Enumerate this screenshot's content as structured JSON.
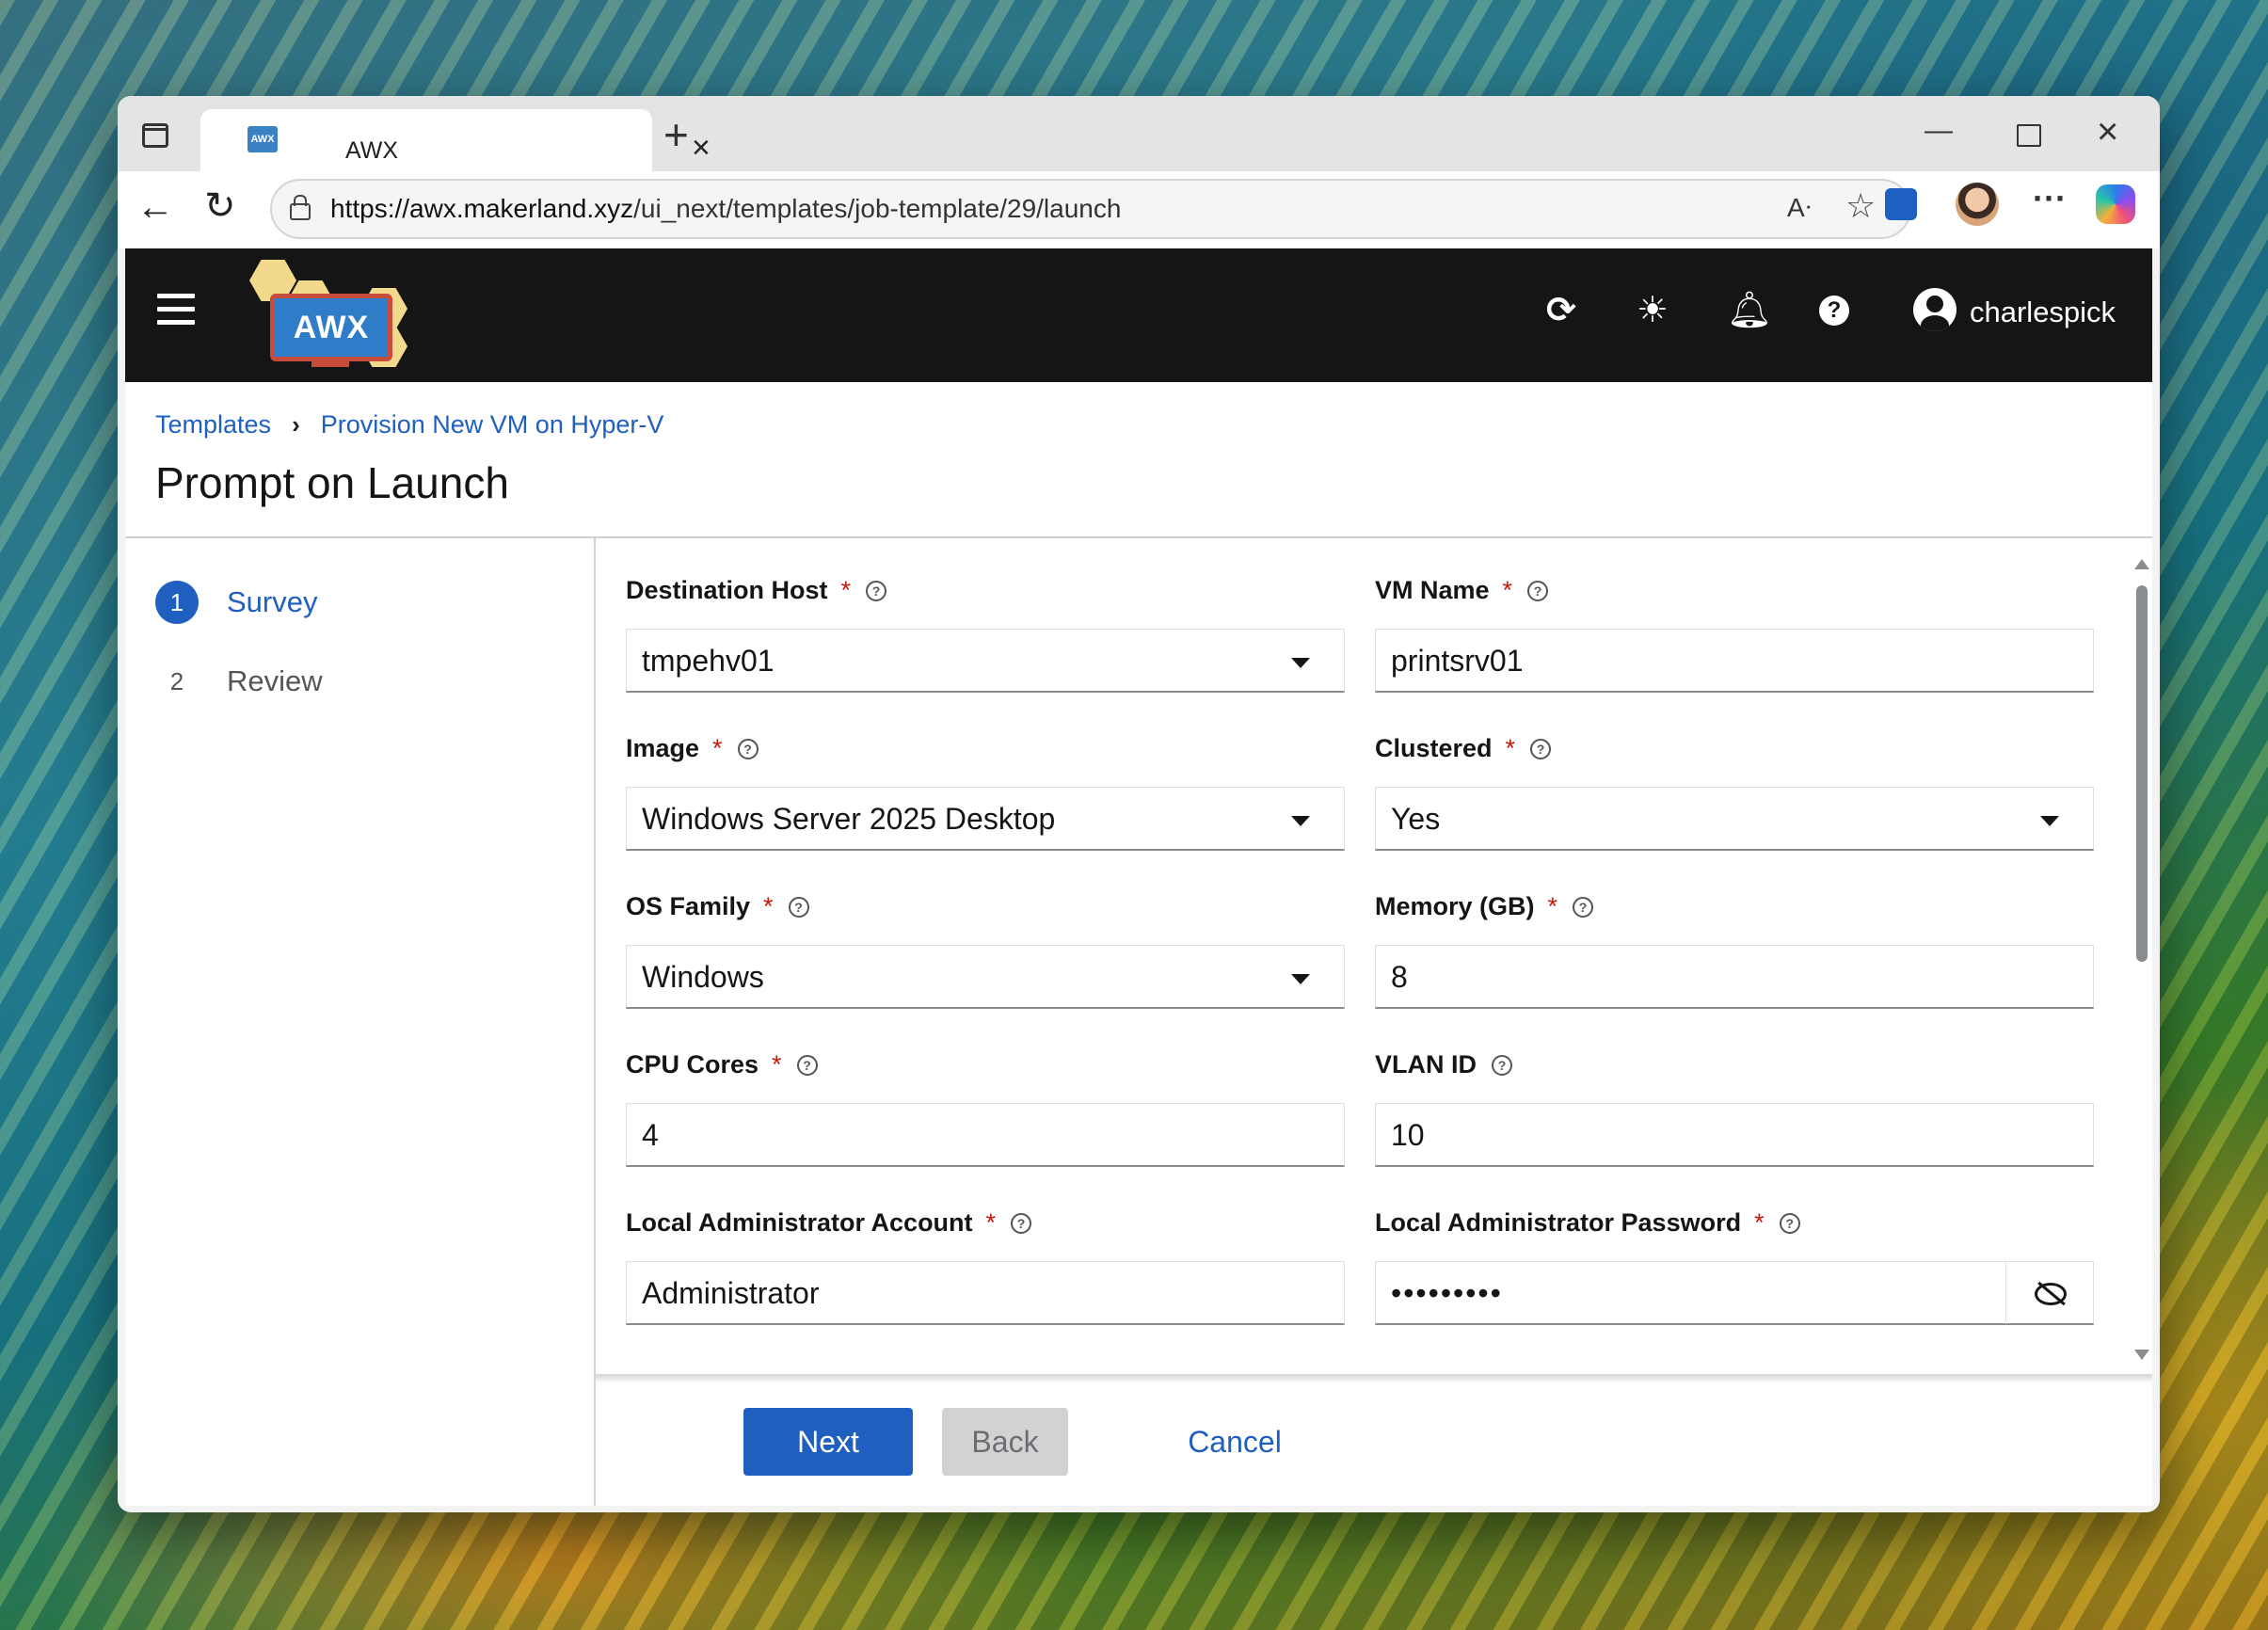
{
  "browser": {
    "tab_title": "AWX",
    "tab_favicon_text": "AWX",
    "url_host": "https://awx.makerland.xyz",
    "url_path": "/ui_next/templates/job-template/29/launch"
  },
  "header": {
    "logo_text": "AWX",
    "username": "charlespick"
  },
  "breadcrumb": {
    "items": [
      "Templates",
      "Provision New VM on Hyper-V"
    ]
  },
  "page": {
    "title": "Prompt on Launch"
  },
  "wizard": {
    "steps": [
      {
        "number": "1",
        "label": "Survey",
        "active": true
      },
      {
        "number": "2",
        "label": "Review",
        "active": false
      }
    ]
  },
  "form": {
    "destination_host": {
      "label": "Destination Host",
      "value": "tmpehv01",
      "required": true
    },
    "vm_name": {
      "label": "VM Name",
      "value": "printsrv01",
      "required": true
    },
    "image": {
      "label": "Image",
      "value": "Windows Server 2025 Desktop",
      "required": true
    },
    "clustered": {
      "label": "Clustered",
      "value": "Yes",
      "required": true
    },
    "os_family": {
      "label": "OS Family",
      "value": "Windows",
      "required": true
    },
    "memory": {
      "label": "Memory (GB)",
      "value": "8",
      "required": true
    },
    "cpu_cores": {
      "label": "CPU Cores",
      "value": "4",
      "required": true
    },
    "vlan_id": {
      "label": "VLAN ID",
      "value": "10",
      "required": false
    },
    "local_admin_account": {
      "label": "Local Administrator Account",
      "value": "Administrator",
      "required": true
    },
    "local_admin_password": {
      "label": "Local Administrator Password",
      "value": "•••••••••",
      "required": true
    },
    "required_marker": "*"
  },
  "footer": {
    "next_label": "Next",
    "back_label": "Back",
    "cancel_label": "Cancel"
  },
  "colors": {
    "accent": "#1f5fbf",
    "masthead": "#151515",
    "required": "#c9190b"
  }
}
